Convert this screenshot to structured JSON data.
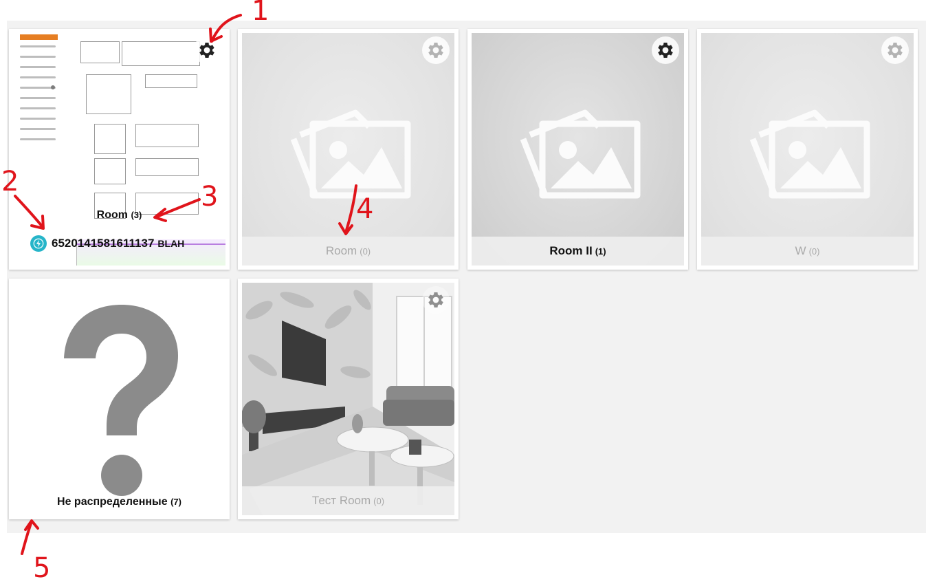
{
  "rooms": [
    {
      "name": "Room",
      "count": "(3)"
    },
    {
      "name": "Room",
      "count": "(0)"
    },
    {
      "name": "Room II",
      "count": "(1)"
    },
    {
      "name": "W",
      "count": "(0)"
    },
    {
      "name": "Не распределенные",
      "count": "(7)"
    },
    {
      "name": "Тест Room",
      "count": "(0)"
    }
  ],
  "device": {
    "id": "6520141581611137",
    "suffix": "BLAH"
  },
  "annotations": [
    "1",
    "2",
    "3",
    "4",
    "5"
  ],
  "icons": {
    "settings": "gear-icon",
    "placeholder": "image-placeholder-icon",
    "unassigned": "question-mark-icon",
    "device": "lightning-badge-icon"
  },
  "colors": {
    "annotation": "#e0141b",
    "background": "#f2f2f2",
    "device_badge": "#26b5c9"
  }
}
